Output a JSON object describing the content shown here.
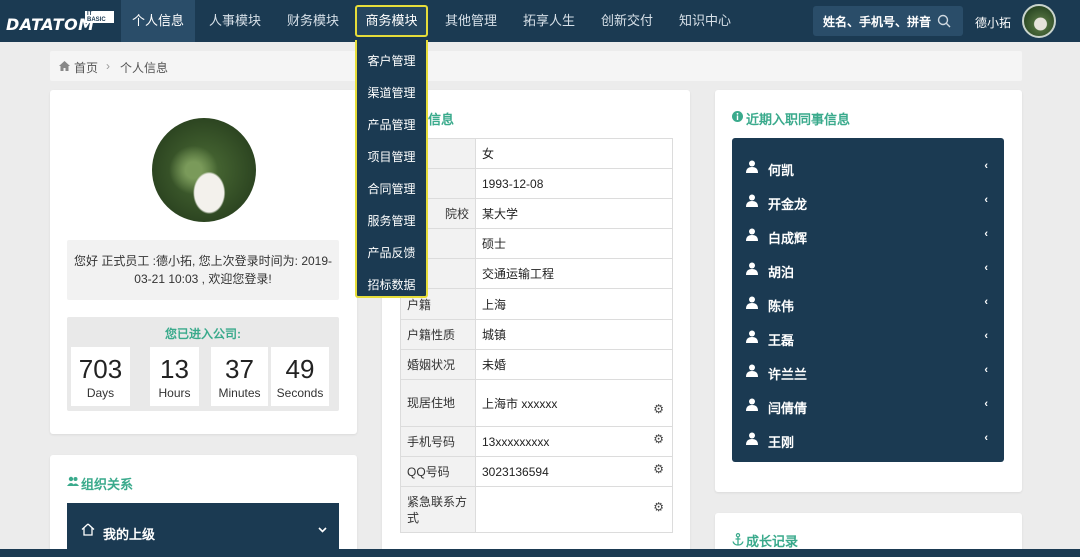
{
  "logo": {
    "word": "DATATOM",
    "sub": "IT BASIC"
  },
  "nav": {
    "items": [
      "个人信息",
      "人事模块",
      "财务模块",
      "商务模块",
      "其他管理",
      "拓享人生",
      "创新交付",
      "知识中心"
    ],
    "search_placeholder": "姓名、手机号、拼音",
    "user_name": "德小拓"
  },
  "dropdown": [
    "客户管理",
    "渠道管理",
    "产品管理",
    "项目管理",
    "合同管理",
    "服务管理",
    "产品反馈",
    "招标数据"
  ],
  "breadcrumb": {
    "home": "首页",
    "sep": "›",
    "current": "个人信息"
  },
  "profile": {
    "welcome": "您好 正式员工 :德小拓, 您上次登录时间为: 2019-03-21 10:03 , 欢迎您登录!",
    "counter_title": "您已进入公司:",
    "counters": [
      {
        "value": "703",
        "unit": "Days"
      },
      {
        "value": "13",
        "unit": "Hours"
      },
      {
        "value": "37",
        "unit": "Minutes"
      },
      {
        "value": "49",
        "unit": "Seconds"
      }
    ]
  },
  "org": {
    "title": "组织关系",
    "superior": "我的上级"
  },
  "info": {
    "title": "信息",
    "rows": [
      {
        "key": "",
        "value": "女"
      },
      {
        "key": "",
        "value": "1993-12-08"
      },
      {
        "key": "院校",
        "value": "某大学"
      },
      {
        "key": "",
        "value": "硕士"
      },
      {
        "key": "",
        "value": "交通运输工程"
      },
      {
        "key": "户籍",
        "value": "上海"
      },
      {
        "key": "户籍性质",
        "value": "城镇"
      },
      {
        "key": "婚姻状况",
        "value": "未婚"
      },
      {
        "key": "现居住地",
        "value": "上海市 xxxxxx"
      },
      {
        "key": "手机号码",
        "value": "13xxxxxxxxx"
      },
      {
        "key": "QQ号码",
        "value": "3023136594"
      },
      {
        "key": "紧急联系方式",
        "value": ""
      }
    ]
  },
  "colleagues": {
    "title": "近期入职同事信息",
    "names": [
      "何凯",
      "开金龙",
      "白成辉",
      "胡泊",
      "陈伟",
      "王磊",
      "许兰兰",
      "闫倩倩",
      "王刚"
    ]
  },
  "growth": {
    "title": "成长记录"
  },
  "colors": {
    "navy": "#1b3a52",
    "accent": "#3aaa8c",
    "highlight": "#e6dd3a"
  }
}
